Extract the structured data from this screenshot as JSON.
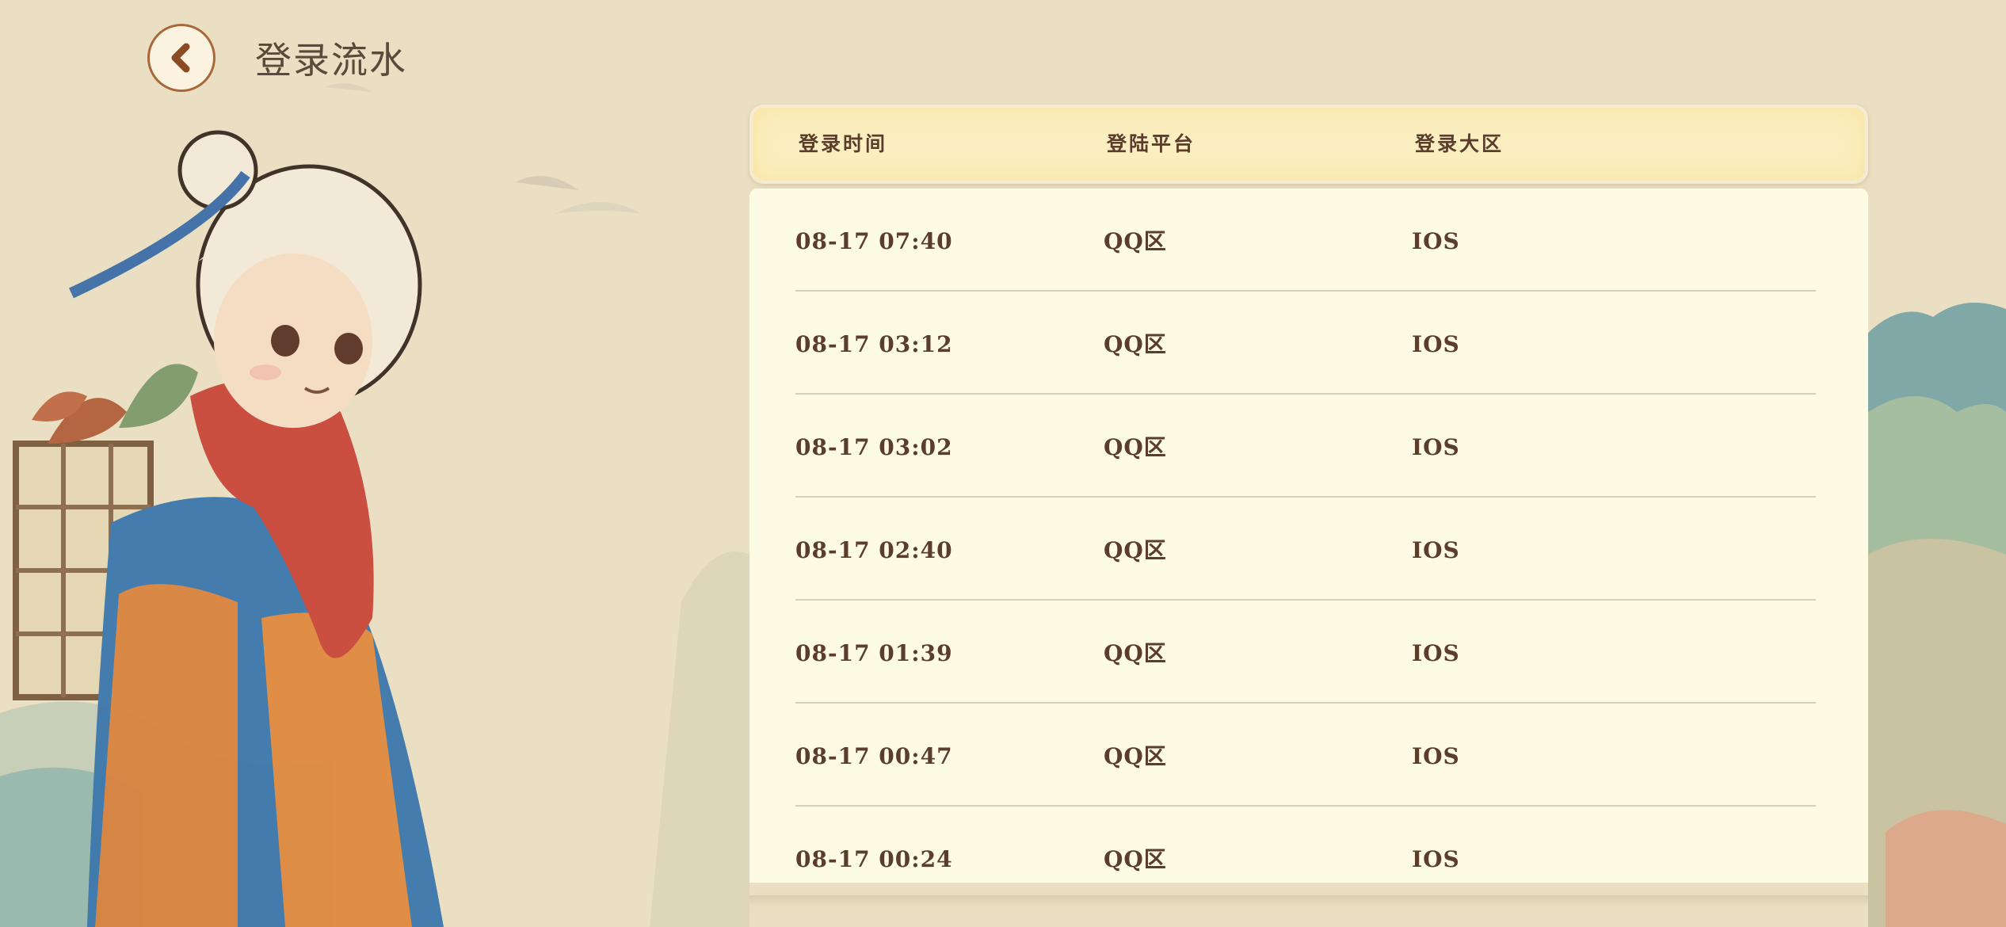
{
  "header": {
    "title": "登录流水"
  },
  "icons": {
    "back": "chevron-left-icon"
  },
  "colors": {
    "accent": "#a8683a",
    "text": "#5a3d2b",
    "table_bg": "#fefbe4",
    "header_bg": "#fbeec0"
  },
  "table": {
    "columns": [
      "登录时间",
      "登陆平台",
      "登录大区"
    ],
    "rows": [
      {
        "time": "08-17 07:40",
        "platform": "QQ区",
        "zone": "IOS"
      },
      {
        "time": "08-17 03:12",
        "platform": "QQ区",
        "zone": "IOS"
      },
      {
        "time": "08-17 03:02",
        "platform": "QQ区",
        "zone": "IOS"
      },
      {
        "time": "08-17 02:40",
        "platform": "QQ区",
        "zone": "IOS"
      },
      {
        "time": "08-17 01:39",
        "platform": "QQ区",
        "zone": "IOS"
      },
      {
        "time": "08-17 00:47",
        "platform": "QQ区",
        "zone": "IOS"
      },
      {
        "time": "08-17 00:24",
        "platform": "QQ区",
        "zone": "IOS"
      }
    ]
  }
}
